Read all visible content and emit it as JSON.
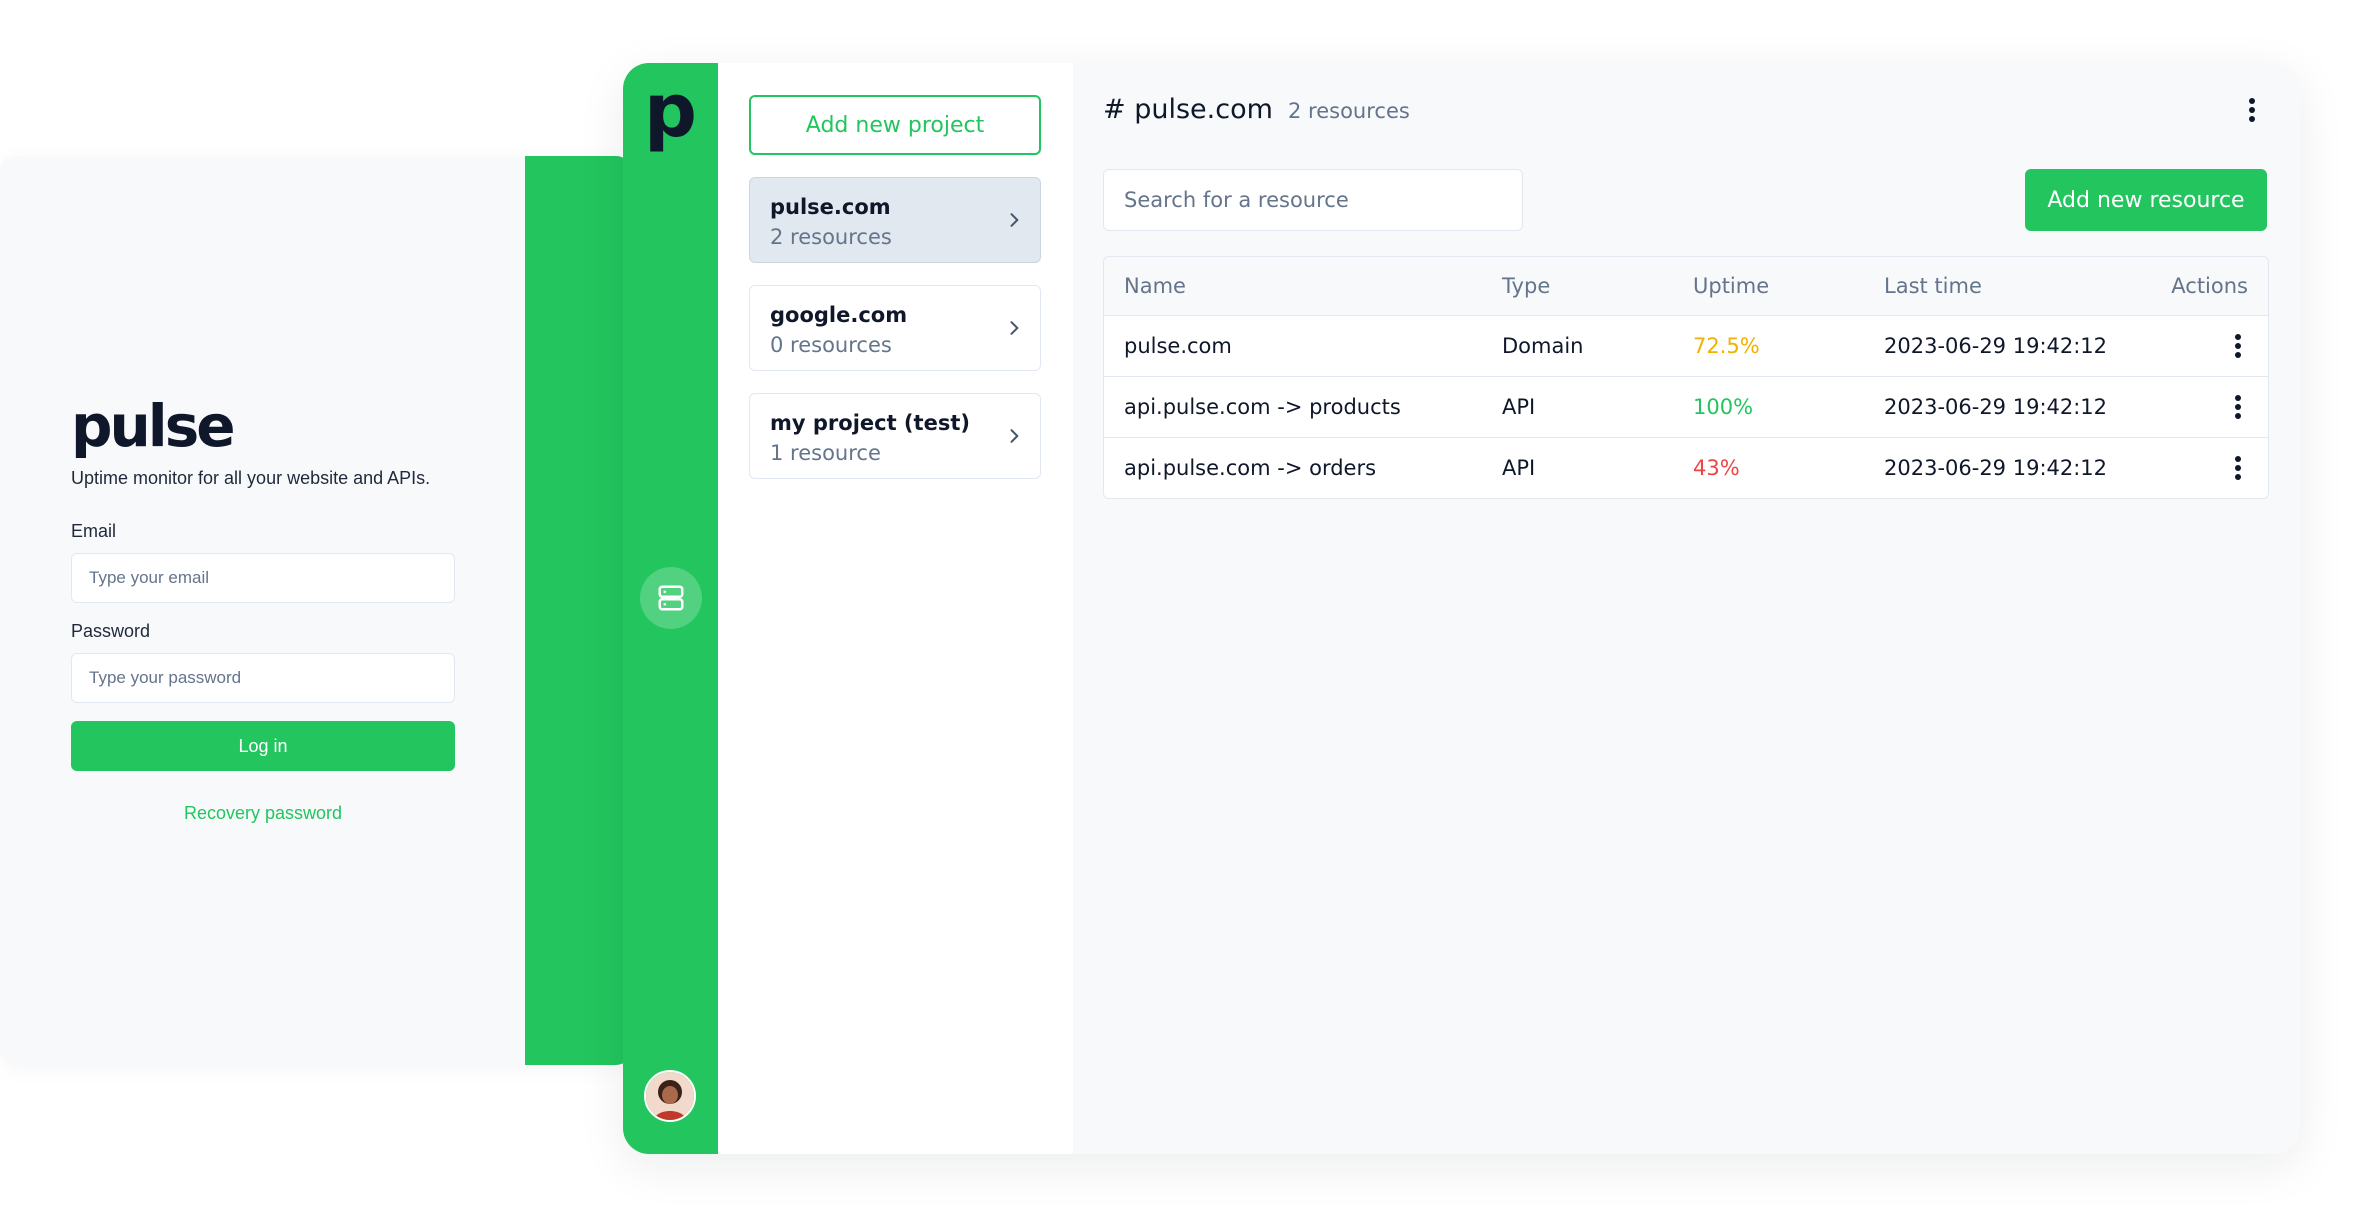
{
  "login": {
    "brand": "pulse",
    "tagline": "Uptime monitor for all your website and APIs.",
    "email_label": "Email",
    "email_placeholder": "Type your email",
    "password_label": "Password",
    "password_placeholder": "Type your password",
    "login_button": "Log in",
    "recovery_link": "Recovery password"
  },
  "rail": {
    "logo": "p",
    "nav_icon": "server-icon",
    "avatar": "user-avatar"
  },
  "projects": {
    "add_button": "Add new project",
    "items": [
      {
        "name": "pulse.com",
        "count": "2 resources",
        "active": true
      },
      {
        "name": "google.com",
        "count": "0 resources",
        "active": false
      },
      {
        "name": "my project (test)",
        "count": "1 resource",
        "active": false
      }
    ]
  },
  "main": {
    "title": "# pulse.com",
    "count": "2 resources",
    "search_placeholder": "Search for a resource",
    "add_button": "Add new resource",
    "columns": [
      "Name",
      "Type",
      "Uptime",
      "Last time",
      "Actions"
    ],
    "rows": [
      {
        "name": "pulse.com",
        "type": "Domain",
        "uptime": "72.5%",
        "uptime_color": "#f0b100",
        "last_time": "2023-06-29 19:42:12"
      },
      {
        "name": "api.pulse.com -> products",
        "type": "API",
        "uptime": "100%",
        "uptime_color": "#22c55e",
        "last_time": "2023-06-29 19:42:12"
      },
      {
        "name": "api.pulse.com -> orders",
        "type": "API",
        "uptime": "43%",
        "uptime_color": "#ef4444",
        "last_time": "2023-06-29 19:42:12"
      }
    ]
  },
  "colors": {
    "accent": "#22c55e",
    "warning": "#f0b100",
    "danger": "#ef4444"
  }
}
